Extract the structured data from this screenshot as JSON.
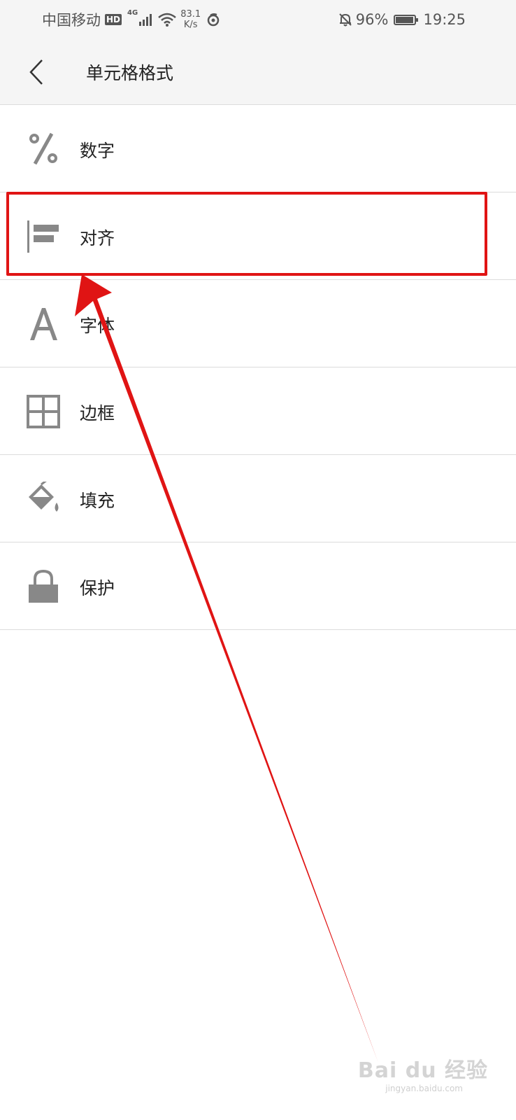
{
  "status_bar": {
    "carrier": "中国移动",
    "hd_badge": "HD",
    "network_type": "4G",
    "speed_value": "83.1",
    "speed_unit": "K/s",
    "battery_percent": "96%",
    "time": "19:25"
  },
  "header": {
    "title": "单元格格式"
  },
  "menu": {
    "items": [
      {
        "label": "数字",
        "icon": "percent-icon"
      },
      {
        "label": "对齐",
        "icon": "align-left-icon"
      },
      {
        "label": "字体",
        "icon": "font-icon"
      },
      {
        "label": "边框",
        "icon": "border-grid-icon"
      },
      {
        "label": "填充",
        "icon": "fill-bucket-icon"
      },
      {
        "label": "保护",
        "icon": "lock-icon"
      }
    ]
  },
  "watermark": {
    "main": "Bai du 经验",
    "sub": "jingyan.baidu.com"
  },
  "colors": {
    "annotation_red": "#e01414",
    "icon_gray": "#888888"
  }
}
